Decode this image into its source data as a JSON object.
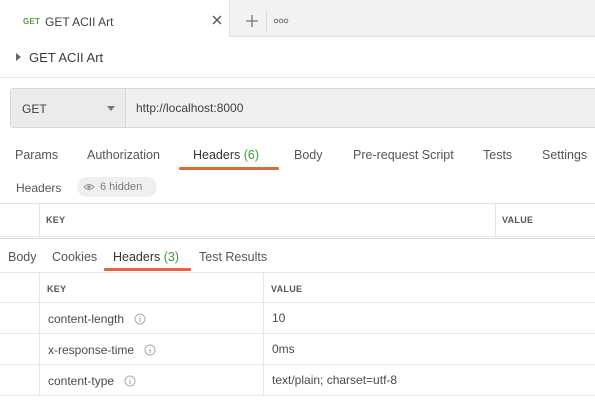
{
  "tabstrip": {
    "active_tab": {
      "method": "GET",
      "title": "GET ACII Art"
    },
    "add_icon": "plus-icon",
    "more_icon": "ellipsis-icon",
    "close_icon": "close-icon"
  },
  "request": {
    "name": "GET ACII Art",
    "method": "GET",
    "url": "http://localhost:8000"
  },
  "request_tabs": [
    {
      "label": "Params",
      "count": ""
    },
    {
      "label": "Authorization",
      "count": ""
    },
    {
      "label": "Headers",
      "count": "(6)"
    },
    {
      "label": "Body",
      "count": ""
    },
    {
      "label": "Pre-request Script",
      "count": ""
    },
    {
      "label": "Tests",
      "count": ""
    },
    {
      "label": "Settings",
      "count": ""
    }
  ],
  "request_headers": {
    "title": "Headers",
    "hidden_label": "6 hidden",
    "columns": {
      "key": "KEY",
      "value": "VALUE"
    }
  },
  "response_tabs": [
    {
      "label": "Body",
      "count": ""
    },
    {
      "label": "Cookies",
      "count": ""
    },
    {
      "label": "Headers",
      "count": "(3)"
    },
    {
      "label": "Test Results",
      "count": ""
    }
  ],
  "response_headers": {
    "columns": {
      "key": "KEY",
      "value": "VALUE"
    },
    "rows": [
      {
        "key": "content-length",
        "value": "10"
      },
      {
        "key": "x-response-time",
        "value": "0ms"
      },
      {
        "key": "content-type",
        "value": "text/plain; charset=utf-8"
      }
    ]
  },
  "colors": {
    "accent": "#e0683a",
    "count_green": "#3b9b3b",
    "get_method": "#5a9b3f"
  }
}
